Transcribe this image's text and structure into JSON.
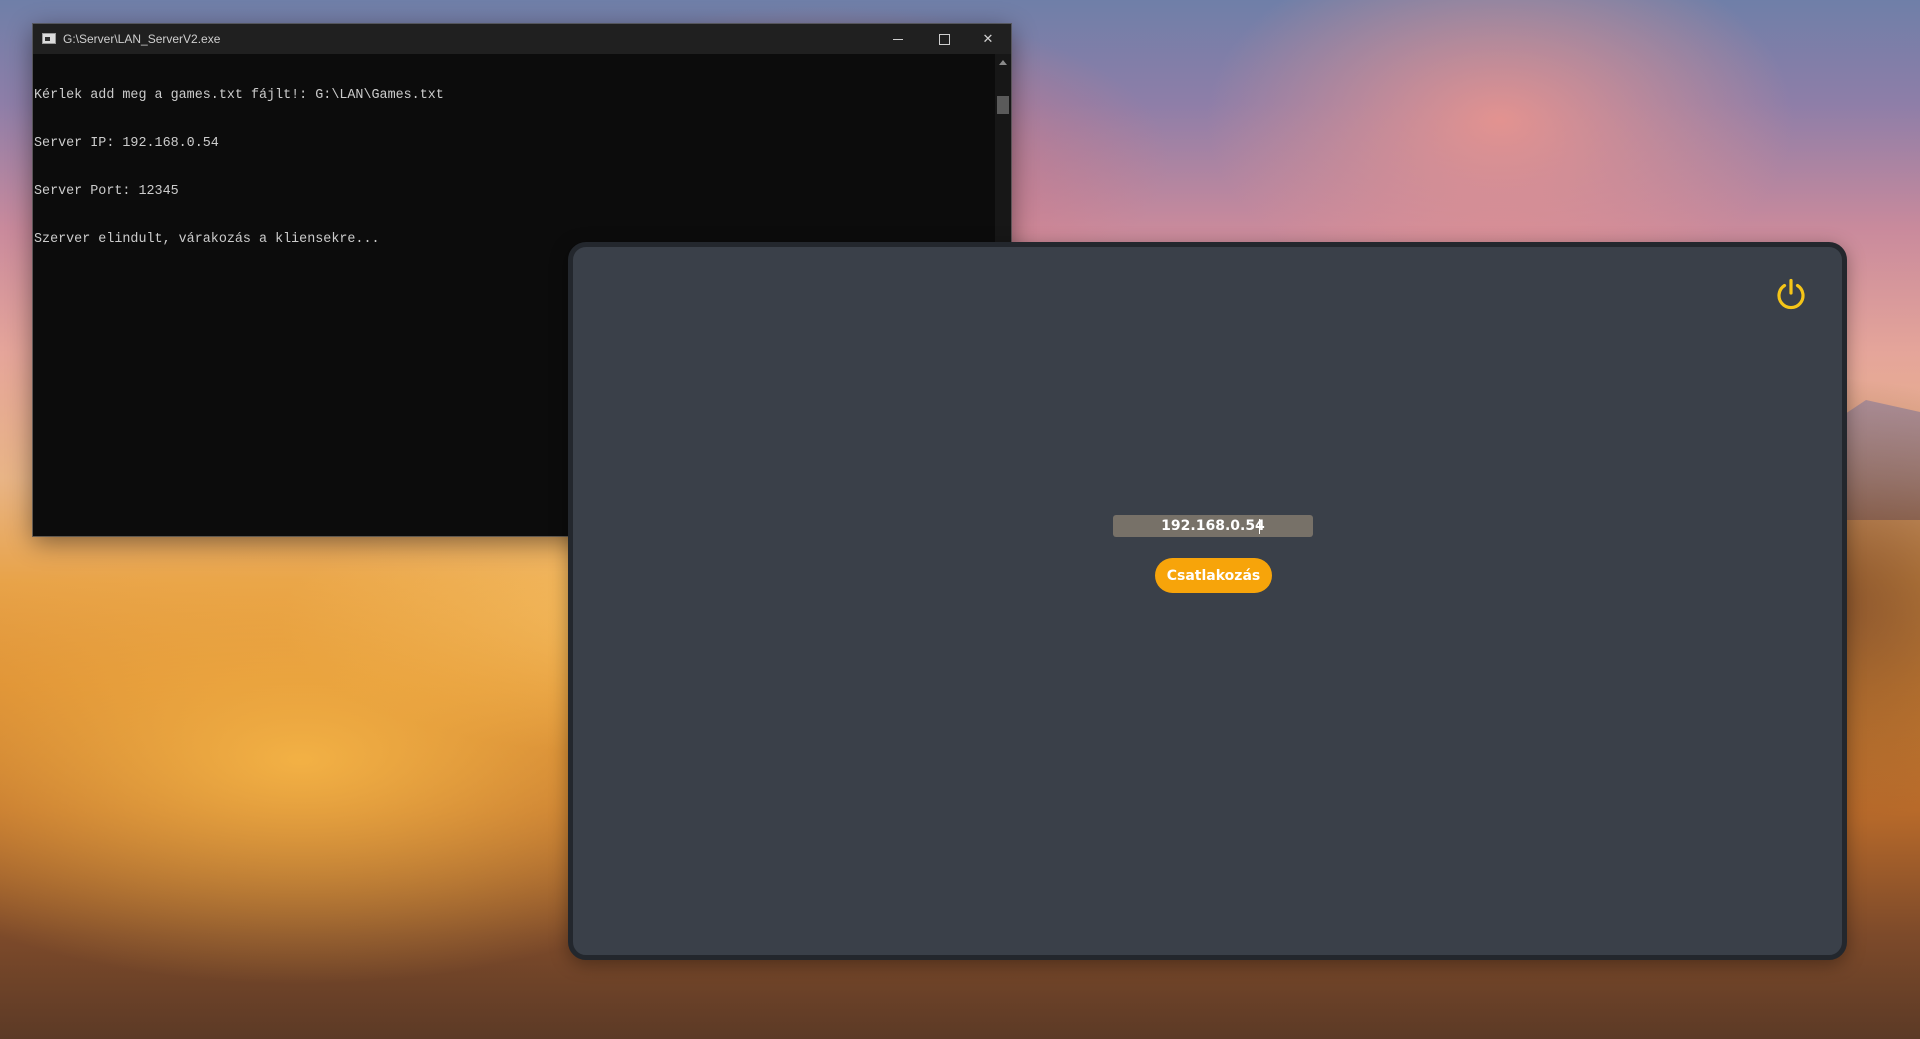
{
  "console": {
    "title": "G:\\Server\\LAN_ServerV2.exe",
    "lines": [
      "Kérlek add meg a games.txt fájlt!: G:\\LAN\\Games.txt",
      "Server IP: 192.168.0.54",
      "Server Port: 12345",
      "Szerver elindult, várakozás a kliensekre..."
    ],
    "controls": {
      "minimize_icon": "minimize-icon",
      "maximize_icon": "maximize-icon",
      "close_icon": "close-icon",
      "close_glyph": "✕"
    }
  },
  "client": {
    "ip_value": "192.168.0.54",
    "connect_label": "Csatlakozás",
    "power_icon": "power-icon"
  },
  "colors": {
    "accent": "#f7a40a",
    "power_icon": "#f5c518",
    "panel_bg": "#3a4049",
    "input_bg": "#777168",
    "console_bg": "#0c0c0c",
    "console_text": "#cccccc"
  }
}
